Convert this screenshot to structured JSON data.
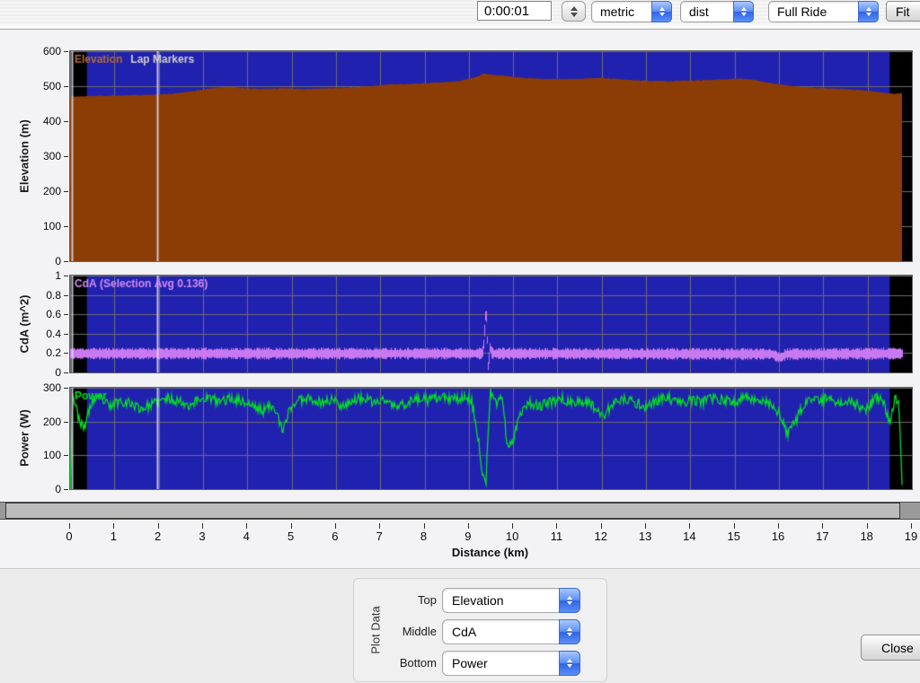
{
  "toolbar": {
    "time_value": "0:00:01",
    "unit_select_value": "metric",
    "xaxis_mode_value": "dist",
    "range_select_value": "Full Ride",
    "fit_button_label": "Fit"
  },
  "x_axis": {
    "label": "Distance (km)",
    "min": 0,
    "max": 19,
    "ticks": [
      0,
      1,
      2,
      3,
      4,
      5,
      6,
      7,
      8,
      9,
      10,
      11,
      12,
      13,
      14,
      15,
      16,
      17,
      18,
      19
    ]
  },
  "plot_data_panel": {
    "group_label": "Plot Data",
    "rows": [
      {
        "label": "Top",
        "value": "Elevation"
      },
      {
        "label": "Middle",
        "value": "CdA"
      },
      {
        "label": "Bottom",
        "value": "Power"
      }
    ]
  },
  "close_button_label": "Close",
  "colors": {
    "plot_bg": "#2121AF",
    "grid": "#6E6E6E",
    "black_band": "#000000",
    "elevation_fill": "#8C3D06",
    "cda_line": "#C878F0",
    "power_line": "#00E020",
    "lap_marker": "#DCDCF0",
    "aqua_accent": "#3D77F2"
  },
  "chart_data": [
    {
      "type": "area",
      "legend": [
        {
          "text": "Elevation",
          "color": "#B06A32"
        },
        {
          "text": "Lap Markers",
          "color": "#CFCFCF"
        }
      ],
      "ylabel": "Elevation (m)",
      "ylim": [
        0,
        600
      ],
      "yticks": [
        0,
        100,
        200,
        300,
        400,
        500,
        600
      ],
      "seed": 7,
      "noise_amp": 1.2,
      "color": "#8C3D06",
      "data_range_km": [
        0,
        18.78
      ],
      "unselected_regions_km": [
        [
          0,
          0.38
        ],
        [
          18.5,
          19
        ]
      ],
      "lap_markers_km": [
        0.05,
        1.97
      ],
      "anchors": [
        [
          0,
          470
        ],
        [
          0.5,
          472
        ],
        [
          1,
          473
        ],
        [
          1.5,
          474
        ],
        [
          2,
          476
        ],
        [
          2.4,
          479
        ],
        [
          2.8,
          487
        ],
        [
          3.2,
          494
        ],
        [
          3.6,
          498
        ],
        [
          3.9,
          494
        ],
        [
          4.3,
          492
        ],
        [
          4.8,
          494
        ],
        [
          5.3,
          492
        ],
        [
          5.8,
          494
        ],
        [
          6.3,
          496
        ],
        [
          6.8,
          500
        ],
        [
          7.2,
          505
        ],
        [
          7.6,
          506
        ],
        [
          8,
          508
        ],
        [
          8.4,
          511
        ],
        [
          8.8,
          515
        ],
        [
          9.1,
          524
        ],
        [
          9.35,
          536
        ],
        [
          9.6,
          532
        ],
        [
          9.9,
          528
        ],
        [
          10.3,
          523
        ],
        [
          10.7,
          520
        ],
        [
          11.1,
          520
        ],
        [
          11.5,
          521
        ],
        [
          11.9,
          524
        ],
        [
          12.3,
          521
        ],
        [
          12.7,
          517
        ],
        [
          13.1,
          515
        ],
        [
          13.5,
          514
        ],
        [
          13.9,
          516
        ],
        [
          14.3,
          517
        ],
        [
          14.7,
          519
        ],
        [
          15.1,
          522
        ],
        [
          15.4,
          518
        ],
        [
          15.8,
          509
        ],
        [
          16.2,
          502
        ],
        [
          16.6,
          497
        ],
        [
          17,
          494
        ],
        [
          17.4,
          492
        ],
        [
          17.8,
          489
        ],
        [
          18.1,
          486
        ],
        [
          18.4,
          481
        ],
        [
          18.6,
          478
        ],
        [
          18.78,
          480
        ]
      ]
    },
    {
      "type": "band",
      "legend": [
        {
          "text": "CdA (Selection Avg 0.136)",
          "color": "#D18BF2"
        }
      ],
      "selection_avg": 0.136,
      "ylabel": "CdA (m^2)",
      "ylim": [
        0,
        1
      ],
      "yticks": [
        0,
        0.2,
        0.4,
        0.6,
        0.8,
        1
      ],
      "seed": 11,
      "band_halfwidth": 0.048,
      "color": "#C878F0",
      "data_range_km": [
        0,
        18.78
      ],
      "unselected_regions_km": [
        [
          0,
          0.38
        ],
        [
          18.5,
          19
        ]
      ],
      "lap_markers_km": [
        0.05,
        1.97
      ],
      "anchors": [
        [
          0,
          0.195
        ],
        [
          9.3,
          0.195
        ],
        [
          9.33,
          0.3
        ],
        [
          9.38,
          0.67
        ],
        [
          9.4,
          0.45
        ],
        [
          9.43,
          0.05
        ],
        [
          9.47,
          0.26
        ],
        [
          9.52,
          0.195
        ],
        [
          15.85,
          0.19
        ],
        [
          15.95,
          0.16
        ],
        [
          16.05,
          0.155
        ],
        [
          16.15,
          0.19
        ],
        [
          18.78,
          0.195
        ]
      ]
    },
    {
      "type": "line",
      "legend": [
        {
          "text": "Power",
          "color": "#00E020"
        }
      ],
      "ylabel": "Power (W)",
      "ylim": [
        0,
        300
      ],
      "yticks": [
        0,
        100,
        200,
        300
      ],
      "seed": 23,
      "noise_amp": 15,
      "color": "#00E020",
      "data_range_km": [
        0,
        18.78
      ],
      "unselected_regions_km": [
        [
          0,
          0.38
        ],
        [
          18.5,
          19
        ]
      ],
      "lap_markers_km": [
        0.05,
        1.97
      ],
      "anchors": [
        [
          0,
          5
        ],
        [
          0.06,
          285
        ],
        [
          0.15,
          230
        ],
        [
          0.3,
          175
        ],
        [
          0.5,
          262
        ],
        [
          0.7,
          268
        ],
        [
          0.9,
          242
        ],
        [
          1.1,
          262
        ],
        [
          1.35,
          255
        ],
        [
          1.6,
          238
        ],
        [
          1.8,
          248
        ],
        [
          2.0,
          258
        ],
        [
          2.2,
          268
        ],
        [
          2.45,
          262
        ],
        [
          2.7,
          248
        ],
        [
          2.9,
          265
        ],
        [
          3.1,
          272
        ],
        [
          3.35,
          258
        ],
        [
          3.6,
          268
        ],
        [
          3.85,
          262
        ],
        [
          4.1,
          248
        ],
        [
          4.35,
          232
        ],
        [
          4.6,
          252
        ],
        [
          4.8,
          165
        ],
        [
          4.95,
          238
        ],
        [
          5.15,
          262
        ],
        [
          5.4,
          272
        ],
        [
          5.65,
          255
        ],
        [
          5.9,
          265
        ],
        [
          6.15,
          248
        ],
        [
          6.4,
          262
        ],
        [
          6.6,
          270
        ],
        [
          6.85,
          255
        ],
        [
          7.1,
          265
        ],
        [
          7.35,
          242
        ],
        [
          7.6,
          255
        ],
        [
          7.85,
          268
        ],
        [
          8.1,
          262
        ],
        [
          8.35,
          272
        ],
        [
          8.6,
          265
        ],
        [
          8.85,
          270
        ],
        [
          9.05,
          268
        ],
        [
          9.2,
          160
        ],
        [
          9.3,
          60
        ],
        [
          9.38,
          3
        ],
        [
          9.48,
          285
        ],
        [
          9.6,
          252
        ],
        [
          9.75,
          278
        ],
        [
          9.88,
          115
        ],
        [
          10.0,
          150
        ],
        [
          10.15,
          225
        ],
        [
          10.35,
          258
        ],
        [
          10.6,
          245
        ],
        [
          10.85,
          258
        ],
        [
          11.1,
          268
        ],
        [
          11.35,
          252
        ],
        [
          11.6,
          262
        ],
        [
          11.85,
          242
        ],
        [
          12.05,
          218
        ],
        [
          12.25,
          252
        ],
        [
          12.5,
          265
        ],
        [
          12.75,
          255
        ],
        [
          13.0,
          245
        ],
        [
          13.25,
          262
        ],
        [
          13.5,
          270
        ],
        [
          13.75,
          252
        ],
        [
          14.0,
          265
        ],
        [
          14.25,
          258
        ],
        [
          14.5,
          268
        ],
        [
          14.75,
          262
        ],
        [
          15.0,
          258
        ],
        [
          15.25,
          272
        ],
        [
          15.5,
          265
        ],
        [
          15.75,
          258
        ],
        [
          16.0,
          225
        ],
        [
          16.2,
          160
        ],
        [
          16.35,
          195
        ],
        [
          16.5,
          235
        ],
        [
          16.7,
          268
        ],
        [
          16.9,
          258
        ],
        [
          17.1,
          272
        ],
        [
          17.35,
          252
        ],
        [
          17.6,
          265
        ],
        [
          17.8,
          245
        ],
        [
          18.0,
          238
        ],
        [
          18.2,
          275
        ],
        [
          18.35,
          255
        ],
        [
          18.5,
          200
        ],
        [
          18.6,
          262
        ],
        [
          18.7,
          272
        ],
        [
          18.78,
          0
        ]
      ]
    }
  ]
}
